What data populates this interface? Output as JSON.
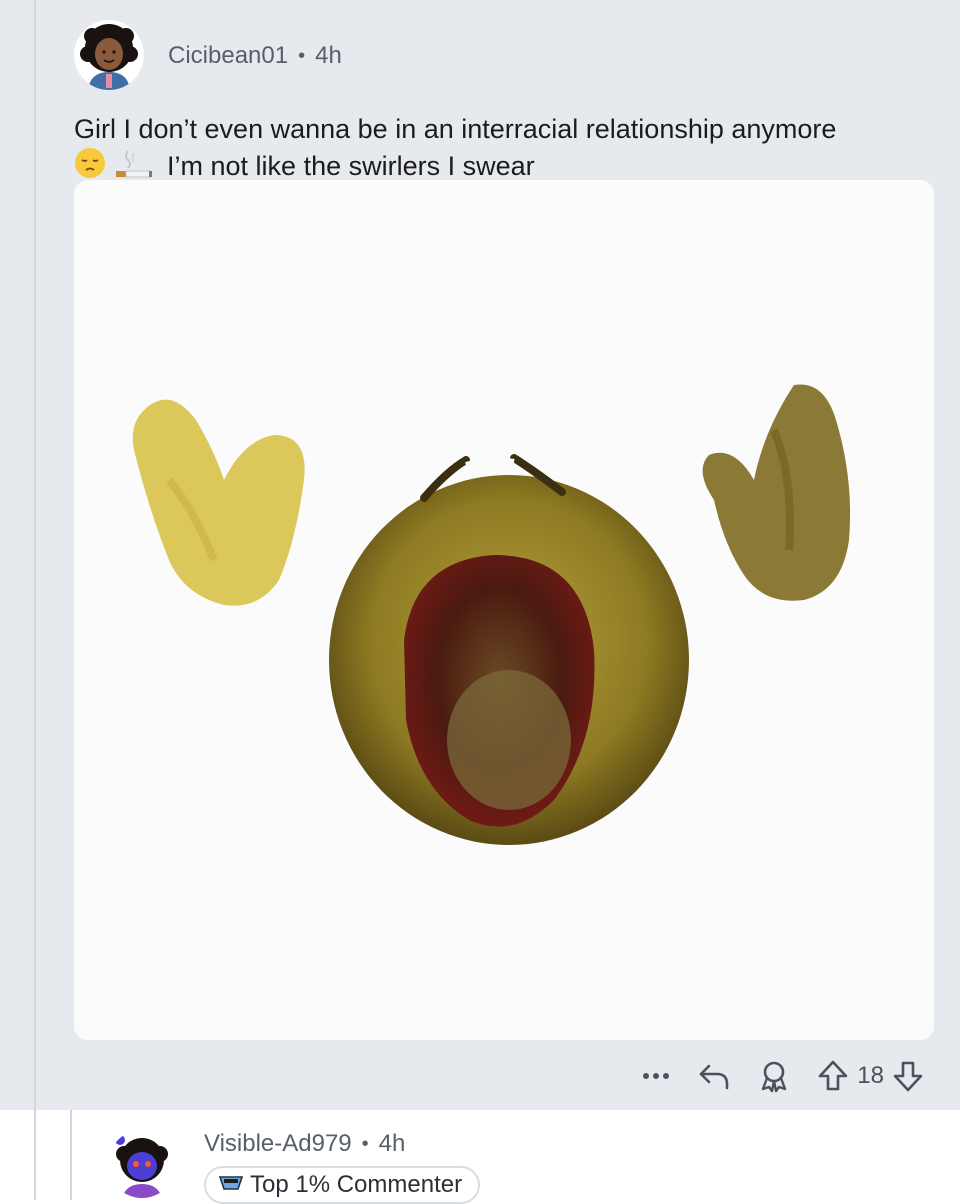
{
  "comment": {
    "username": "Cicibean01",
    "separator": "•",
    "time": "4h",
    "text_line1": "Girl I don’t even wanna be in an interracial relationship anymore",
    "text_line2": "I’m not like the swirlers I swear",
    "emojis": [
      "pensive-face-emoji",
      "cigarette-emoji"
    ],
    "media": "screaming-emoji-image",
    "actions": {
      "more": "more-options-icon",
      "reply": "reply-icon",
      "award": "award-icon",
      "upvote": "upvote-icon",
      "score": "18",
      "downvote": "downvote-icon"
    }
  },
  "reply": {
    "username": "Visible-Ad979",
    "separator": "•",
    "time": "4h",
    "badge": "Top 1% Commenter",
    "badge_icon": "top-commenter-icon"
  },
  "colors": {
    "comment_bg": "#e6e9ee",
    "meta_text": "#576069",
    "text": "#1c1c1c"
  }
}
